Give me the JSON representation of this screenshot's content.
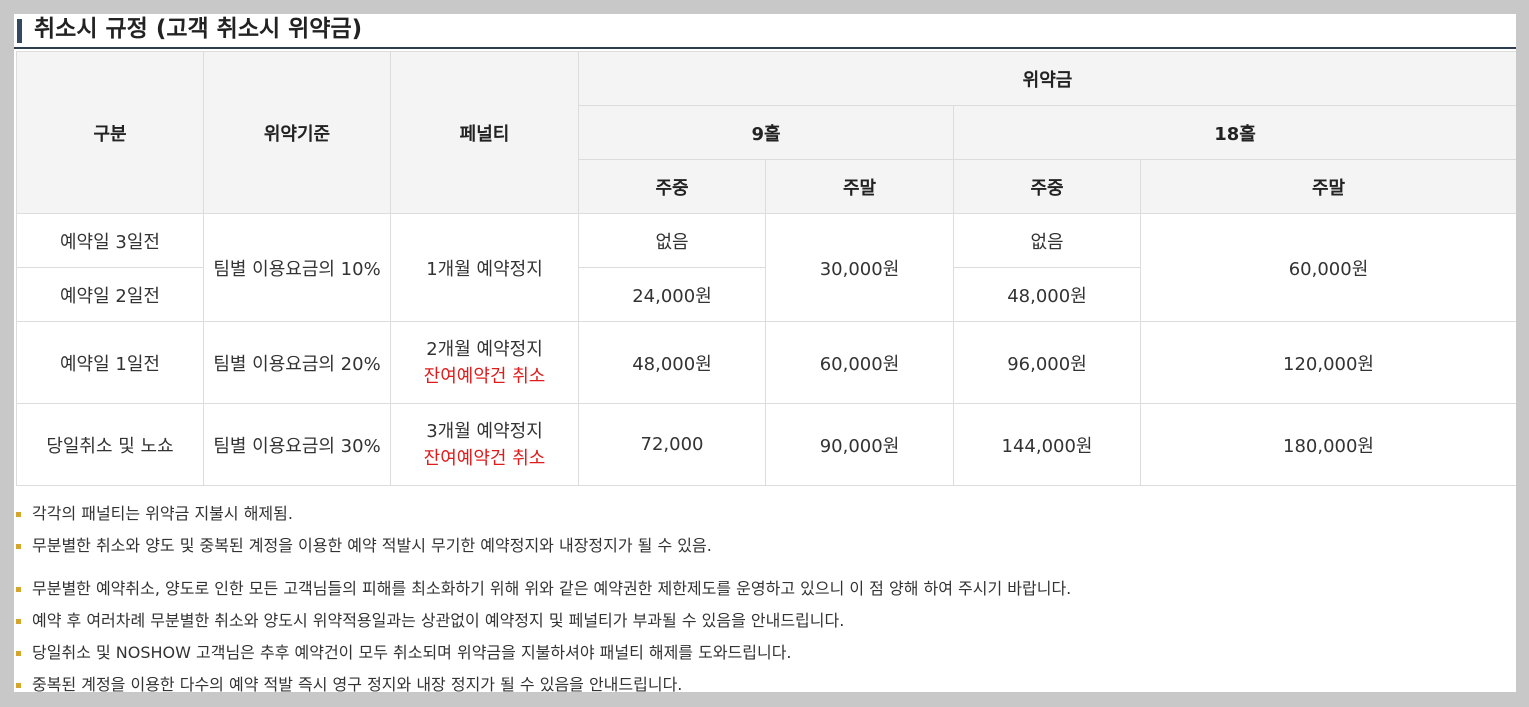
{
  "title": "취소시 규정 (고객 취소시 위약금)",
  "table": {
    "headers": {
      "category": "구분",
      "basis": "위약기준",
      "penalty": "페널티",
      "fee": "위약금",
      "hole9": "9홀",
      "hole18": "18홀",
      "weekday": "주중",
      "weekend": "주말"
    },
    "rows": {
      "d3": {
        "category": "예약일 3일전",
        "h9_weekday": "없음",
        "h18_weekday": "없음"
      },
      "d2": {
        "category": "예약일 2일전",
        "h9_weekday": "24,000원",
        "h18_weekday": "48,000원"
      },
      "d3d2_shared": {
        "basis": "팀별 이용요금의 10%",
        "penalty": "1개월 예약정지",
        "h9_weekend": "30,000원",
        "h18_weekend": "60,000원"
      },
      "d1": {
        "category": "예약일 1일전",
        "basis": "팀별 이용요금의 20%",
        "penalty": "2개월 예약정지",
        "penalty_extra": "잔여예약건 취소",
        "h9_weekday": "48,000원",
        "h9_weekend": "60,000원",
        "h18_weekday": "96,000원",
        "h18_weekend": "120,000원"
      },
      "same": {
        "category": "당일취소 및 노쇼",
        "basis": "팀별 이용요금의 30%",
        "penalty": "3개월 예약정지",
        "penalty_extra": "잔여예약건 취소",
        "h9_weekday": "72,000",
        "h9_weekend": "90,000원",
        "h18_weekday": "144,000원",
        "h18_weekend": "180,000원"
      }
    }
  },
  "notes": [
    "각각의 패널티는 위약금 지불시 해제됨.",
    "무분별한 취소와 양도 및 중복된 계정을 이용한 예약 적발시 무기한 예약정지와 내장정지가 될 수 있음.",
    "무분별한 예약취소, 양도로 인한 모든 고객님들의 피해를 최소화하기 위해 위와 같은 예약권한 제한제도를 운영하고 있으니 이 점 양해 하여 주시기 바랍니다.",
    "예약 후 여러차례 무분별한 취소와 양도시 위약적용일과는 상관없이 예약정지 및 페널티가 부과될 수 있음을 안내드립니다.",
    "당일취소 및 NOSHOW 고객님은 추후 예약건이 모두 취소되며 위약금을 지불하셔야 패널티 해제를 도와드립니다.",
    "중복된 계정을 이용한 다수의 예약 적발 즉시 영구 정지와 내장 정지가 될 수 있음을 안내드립니다."
  ],
  "colors": {
    "accent_red": "#e01b1b",
    "bullet": "#d4a72c",
    "title_bar": "#34495e",
    "header_bg": "#f4f4f4"
  }
}
